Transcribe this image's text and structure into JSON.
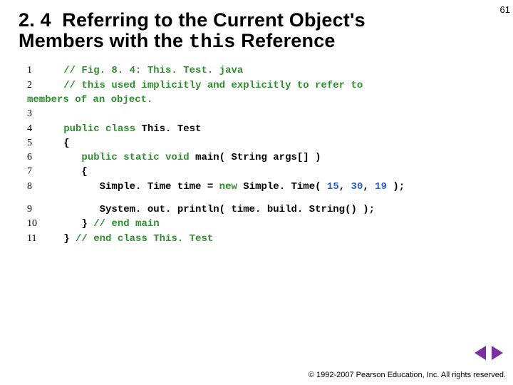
{
  "page_number": "61",
  "heading": {
    "section_number": "2. 4",
    "text_before_code": "Referring to the Current Object's Members with the",
    "code_word": "this",
    "text_after_code": "Reference"
  },
  "code_block1": {
    "l1_num": "1",
    "l1_comment": "// Fig. 8. 4: This. Test. java",
    "l2_num": "2",
    "l2_comment": "// this used implicitly and explicitly to refer to",
    "l2b_comment": "members of an object.",
    "l3_num": "3",
    "l4_num": "4",
    "l4_kw1": "public class",
    "l4_name": "This. Test",
    "l5_num": "5",
    "l5_text": "{",
    "l6_num": "6",
    "l6_kw": "public static void",
    "l6_name": "main( String args[] )",
    "l7_num": "7",
    "l7_text": "{",
    "l8_num": "8",
    "l8_a": "Simple. Time time =",
    "l8_kw": "new",
    "l8_b": "Simple. Time(",
    "l8_v1": "15",
    "l8_c1": ",",
    "l8_v2": "30",
    "l8_c2": ",",
    "l8_v3": "19",
    "l8_end": ");"
  },
  "code_block2": {
    "l9_num": "9",
    "l9_text": "System. out. println( time. build. String() );",
    "l10_num": "10",
    "l10_text": "}",
    "l10_comment": "// end main",
    "l11_num": "11",
    "l11_text": "}",
    "l11_comment": "// end class This. Test"
  },
  "footer": {
    "copyright": "© 1992-2007 Pearson Education, Inc. All rights reserved."
  },
  "nav": {
    "prev_icon": "prev-arrow",
    "next_icon": "next-arrow"
  }
}
